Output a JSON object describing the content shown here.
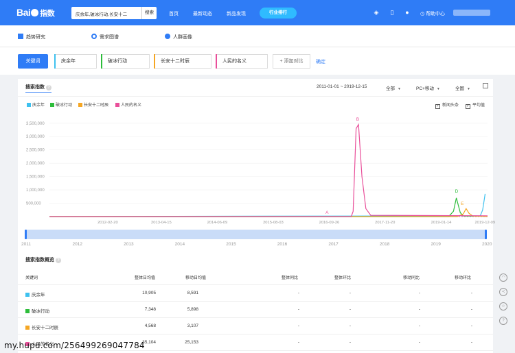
{
  "header": {
    "logo_text_1": "Bai",
    "logo_text_2": "指数",
    "search_value": "庆余年,破冰行动,长安十二",
    "search_button": "搜索",
    "nav": [
      "首页",
      "最新动态",
      "新品发现"
    ],
    "industry_button": "行业排行",
    "help": "帮助中心"
  },
  "subnav": {
    "items": [
      "趋势研究",
      "需求图谱",
      "人群画像"
    ]
  },
  "keywords": {
    "label": "关键词",
    "items": [
      {
        "name": "庆余年",
        "color": "#3ec1ef"
      },
      {
        "name": "破冰行动",
        "color": "#2dbd3b"
      },
      {
        "name": "长安十二时辰",
        "color": "#f5a623"
      },
      {
        "name": "人民的名义",
        "color": "#e94f9a"
      }
    ],
    "add": "+ 添加对比",
    "confirm": "确定"
  },
  "panel": {
    "title": "搜索指数",
    "date_range": "2011-01-01 ~ 2019-12-15",
    "region": "全部",
    "device": "PC+移动",
    "area": "全国",
    "news_check": "新闻头条",
    "avg_check": "平均值"
  },
  "chart_data": {
    "type": "line",
    "yticks": [
      "3,500,000",
      "3,000,000",
      "2,500,000",
      "2,000,000",
      "1,500,000",
      "1,000,000",
      "500,000"
    ],
    "xticks": [
      "2012-02-20",
      "2013-04-15",
      "2014-06-09",
      "2015-08-03",
      "2016-09-26",
      "2017-11-20",
      "2019-01-14",
      "2019-12-09"
    ],
    "ylim": [
      0,
      3700000
    ],
    "xlim": [
      2011.0,
      2020.0
    ],
    "series": [
      {
        "name": "庆余年",
        "color": "#3ec1ef",
        "x": [
          2011.0,
          2019.85,
          2019.9,
          2019.95
        ],
        "y": [
          0,
          30000,
          250000,
          850000
        ]
      },
      {
        "name": "破冰行动",
        "color": "#2dbd3b",
        "x": [
          2011.0,
          2019.2,
          2019.3,
          2019.36,
          2019.44,
          2019.5,
          2020.0
        ],
        "y": [
          0,
          0,
          200000,
          700000,
          150000,
          20000,
          10000
        ]
      },
      {
        "name": "长安十二时辰",
        "color": "#f5a623",
        "x": [
          2011.0,
          2019.38,
          2019.5,
          2019.56,
          2019.62,
          2019.7,
          2020.0
        ],
        "y": [
          0,
          0,
          100000,
          300000,
          120000,
          20000,
          10000
        ]
      },
      {
        "name": "人民的名义",
        "color": "#e94f9a",
        "x": [
          2011.0,
          2017.2,
          2017.24,
          2017.3,
          2017.35,
          2017.42,
          2017.5,
          2017.6,
          2020.0
        ],
        "y": [
          0,
          0,
          200000,
          3300000,
          3450000,
          1500000,
          300000,
          50000,
          30000
        ]
      }
    ],
    "event_markers": [
      {
        "label": "A",
        "x": 2016.7,
        "color": "#e94f9a"
      },
      {
        "label": "B",
        "x": 2017.33,
        "color": "#e94f9a"
      },
      {
        "label": "D",
        "x": 2019.36,
        "color": "#2dbd3b"
      },
      {
        "label": "E",
        "x": 2019.48,
        "color": "#f5a623"
      }
    ],
    "timeline_years": [
      "2011",
      "2012",
      "2013",
      "2014",
      "2015",
      "2016",
      "2017",
      "2018",
      "2019",
      "2020"
    ]
  },
  "overview": {
    "title": "搜索指数概览",
    "headers": [
      "关键词",
      "整体日均值",
      "移动日均值",
      "整体同比",
      "整体环比",
      "移动同比",
      "移动环比"
    ],
    "rows": [
      {
        "name": "庆余年",
        "color": "#3ec1ef",
        "overall": "10,905",
        "mobile": "8,591",
        "yoy": "-",
        "mom": "-",
        "m_yoy": "-",
        "m_mom": "-"
      },
      {
        "name": "破冰行动",
        "color": "#2dbd3b",
        "overall": "7,348",
        "mobile": "5,898",
        "yoy": "-",
        "mom": "-",
        "m_yoy": "-",
        "m_mom": "-"
      },
      {
        "name": "长安十二时辰",
        "color": "#f5a623",
        "overall": "4,568",
        "mobile": "3,107",
        "yoy": "-",
        "mom": "-",
        "m_yoy": "-",
        "m_mom": "-"
      },
      {
        "name": "人民的名义",
        "color": "#e94f9a",
        "overall": "35,104",
        "mobile": "25,153",
        "yoy": "-",
        "mom": "-",
        "m_yoy": "-",
        "m_mom": "-"
      }
    ]
  },
  "watermark": "my.hupu.com/256499269047784"
}
